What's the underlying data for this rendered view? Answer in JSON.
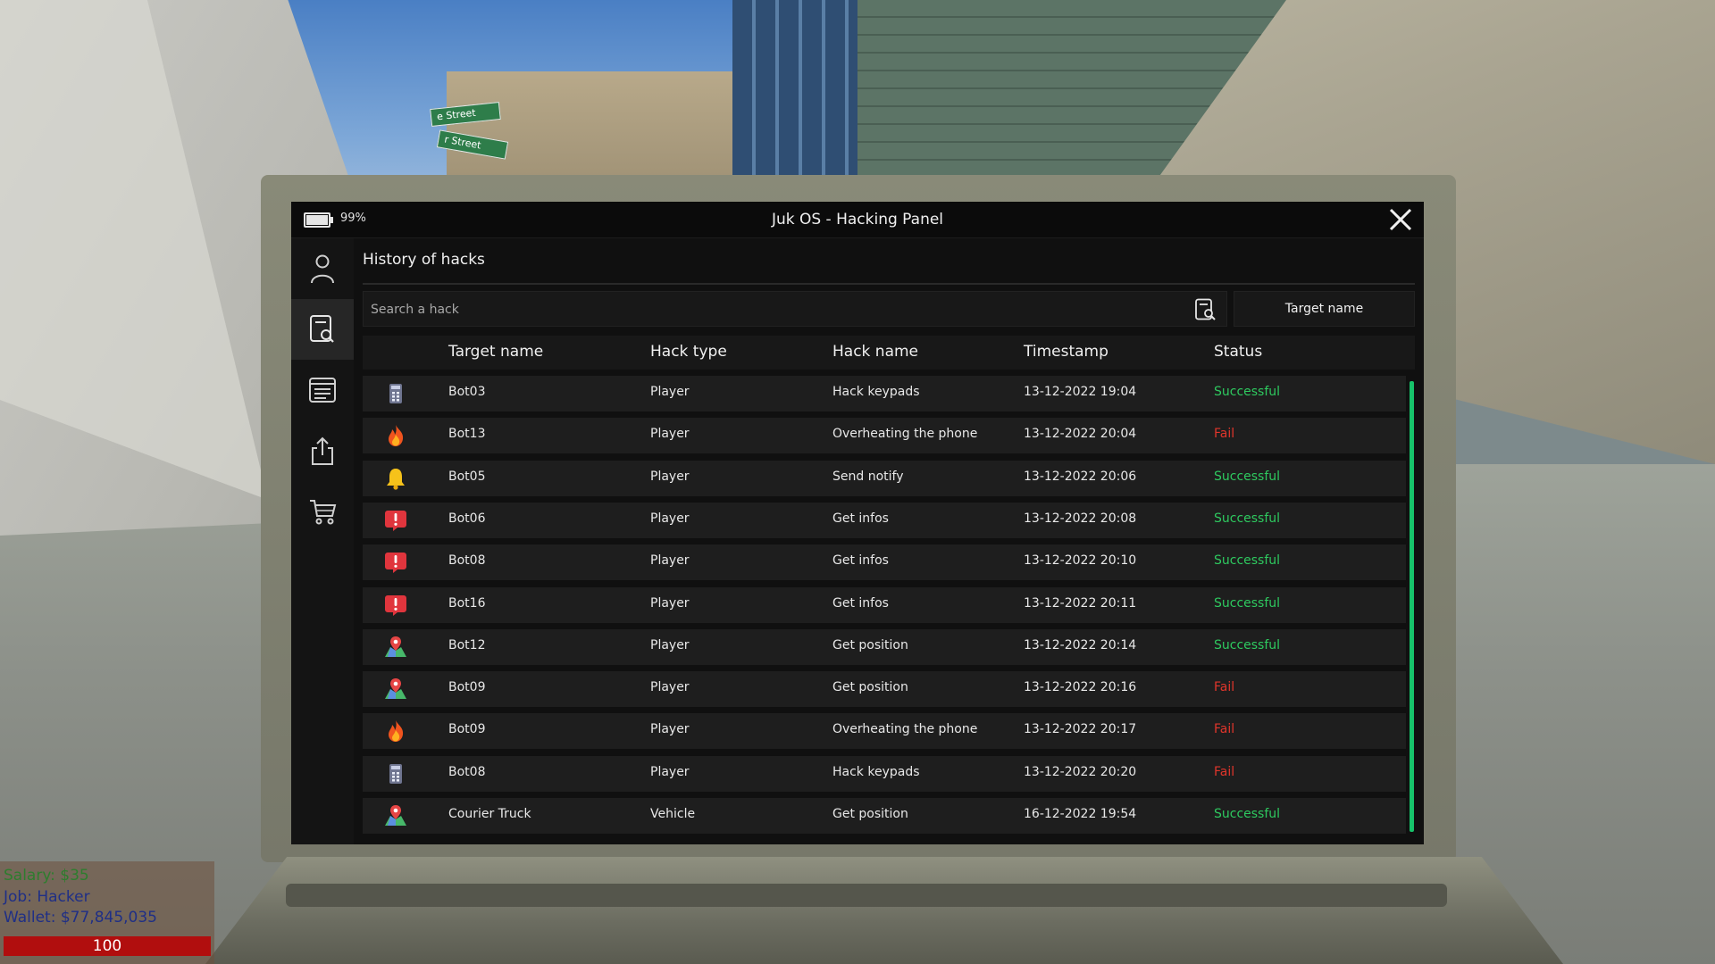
{
  "window": {
    "title": "Juk OS - Hacking Panel",
    "battery_text": "99%",
    "battery_level": 0.99
  },
  "sidebar": {
    "items": [
      {
        "icon": "user-icon"
      },
      {
        "icon": "search-document-icon",
        "active": true
      },
      {
        "icon": "list-icon"
      },
      {
        "icon": "upload-icon"
      },
      {
        "icon": "cart-icon"
      }
    ]
  },
  "page": {
    "title": "History of hacks"
  },
  "search": {
    "placeholder": "Search a hack",
    "value": "",
    "filter_label": "Target name"
  },
  "table": {
    "columns": [
      "Target name",
      "Hack type",
      "Hack name",
      "Timestamp",
      "Status"
    ],
    "rows": [
      {
        "icon": "keypad-icon",
        "target": "Bot03",
        "type": "Player",
        "hack": "Hack keypads",
        "timestamp": "13-12-2022 19:04",
        "status": "Successful"
      },
      {
        "icon": "fire-icon",
        "target": "Bot13",
        "type": "Player",
        "hack": "Overheating the phone",
        "timestamp": "13-12-2022 20:04",
        "status": "Fail"
      },
      {
        "icon": "bell-icon",
        "target": "Bot05",
        "type": "Player",
        "hack": "Send notify",
        "timestamp": "13-12-2022 20:06",
        "status": "Successful"
      },
      {
        "icon": "alert-icon",
        "target": "Bot06",
        "type": "Player",
        "hack": "Get infos",
        "timestamp": "13-12-2022 20:08",
        "status": "Successful"
      },
      {
        "icon": "alert-icon",
        "target": "Bot08",
        "type": "Player",
        "hack": "Get infos",
        "timestamp": "13-12-2022 20:10",
        "status": "Successful"
      },
      {
        "icon": "alert-icon",
        "target": "Bot16",
        "type": "Player",
        "hack": "Get infos",
        "timestamp": "13-12-2022 20:11",
        "status": "Successful"
      },
      {
        "icon": "map-pin-icon",
        "target": "Bot12",
        "type": "Player",
        "hack": "Get position",
        "timestamp": "13-12-2022 20:14",
        "status": "Successful"
      },
      {
        "icon": "map-pin-icon",
        "target": "Bot09",
        "type": "Player",
        "hack": "Get position",
        "timestamp": "13-12-2022 20:16",
        "status": "Fail"
      },
      {
        "icon": "fire-icon",
        "target": "Bot09",
        "type": "Player",
        "hack": "Overheating the phone",
        "timestamp": "13-12-2022 20:17",
        "status": "Fail"
      },
      {
        "icon": "keypad-icon",
        "target": "Bot08",
        "type": "Player",
        "hack": "Hack keypads",
        "timestamp": "13-12-2022 20:20",
        "status": "Fail"
      },
      {
        "icon": "map-pin-icon",
        "target": "Courier Truck",
        "type": "Vehicle",
        "hack": "Get position",
        "timestamp": "16-12-2022 19:54",
        "status": "Successful"
      }
    ]
  },
  "hud": {
    "salary": "Salary: $35",
    "job": "Job: Hacker",
    "wallet": "Wallet: $77,845,035",
    "health": "100"
  },
  "world": {
    "street_sign_1": "e Street",
    "street_sign_2": "r Street"
  },
  "colors": {
    "success": "#2ec95f",
    "fail": "#e0352b",
    "scrollbar": "#17c26a",
    "health_bar": "#b10e0e"
  }
}
